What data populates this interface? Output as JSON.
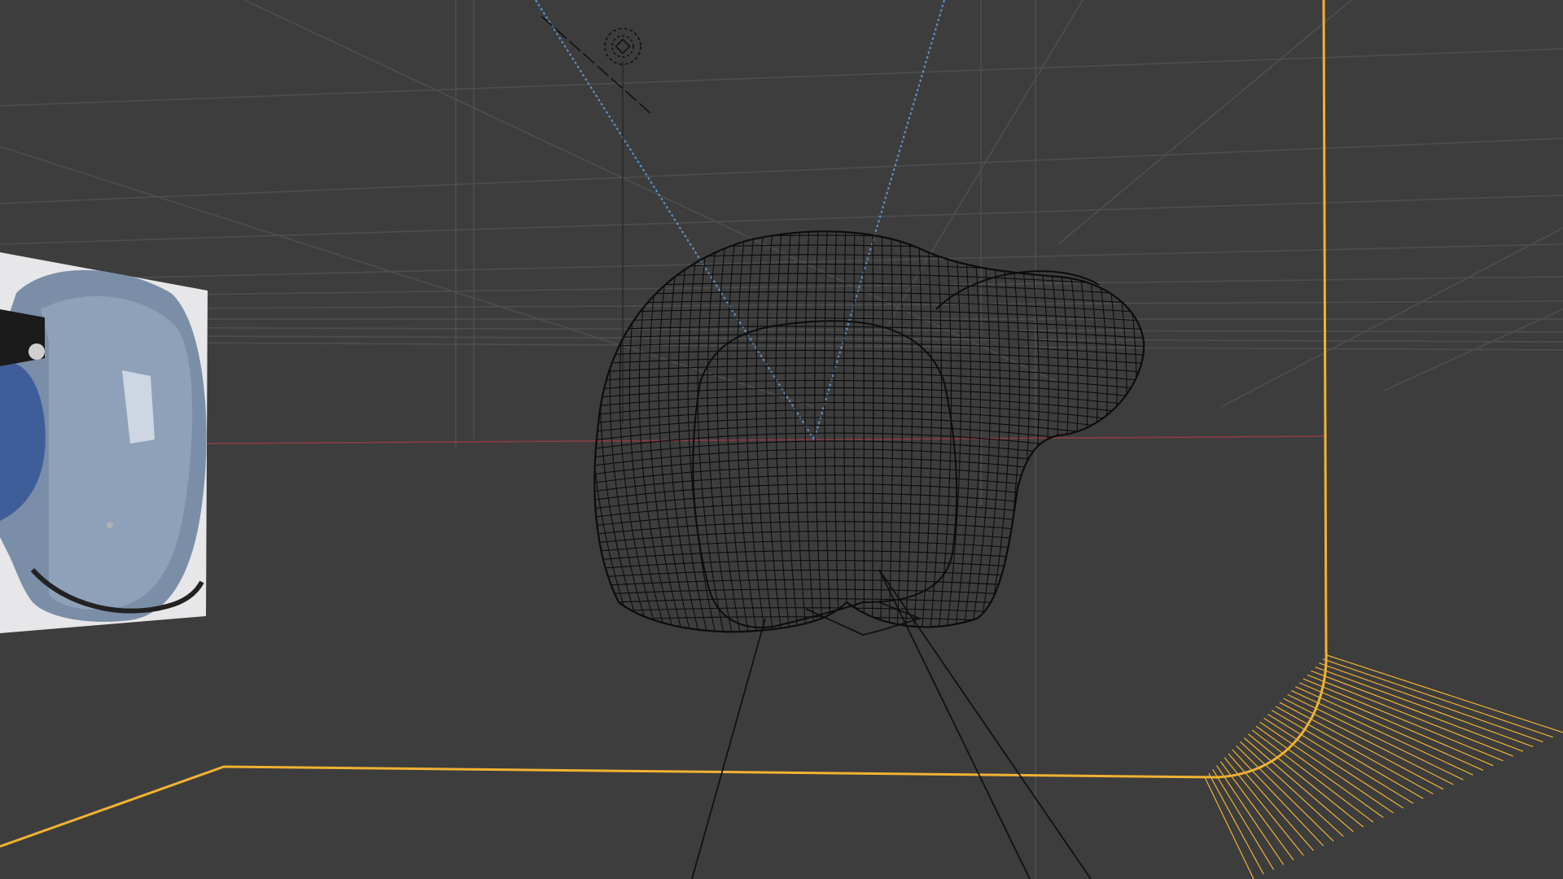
{
  "viewport": {
    "mode": "wireframe",
    "background_color": "#3d3d3d",
    "grid_color": "#4e4e4e",
    "selection_outline_color": "#f0b232",
    "x_axis_color": "#8c3b44",
    "wireframe_color": "#0c0c0c",
    "light_link_color": "#5a8ec4"
  },
  "objects": {
    "backdrop": {
      "name": "backdrop-cyclorama",
      "selected": true
    },
    "helmet": {
      "name": "helmet-wireframe-mesh"
    },
    "reference_image": {
      "name": "helmet-reference-image",
      "icon": "helmet-image"
    },
    "light": {
      "name": "spot-light",
      "icon": "light-icon"
    },
    "camera": {
      "name": "camera-frustum"
    }
  }
}
